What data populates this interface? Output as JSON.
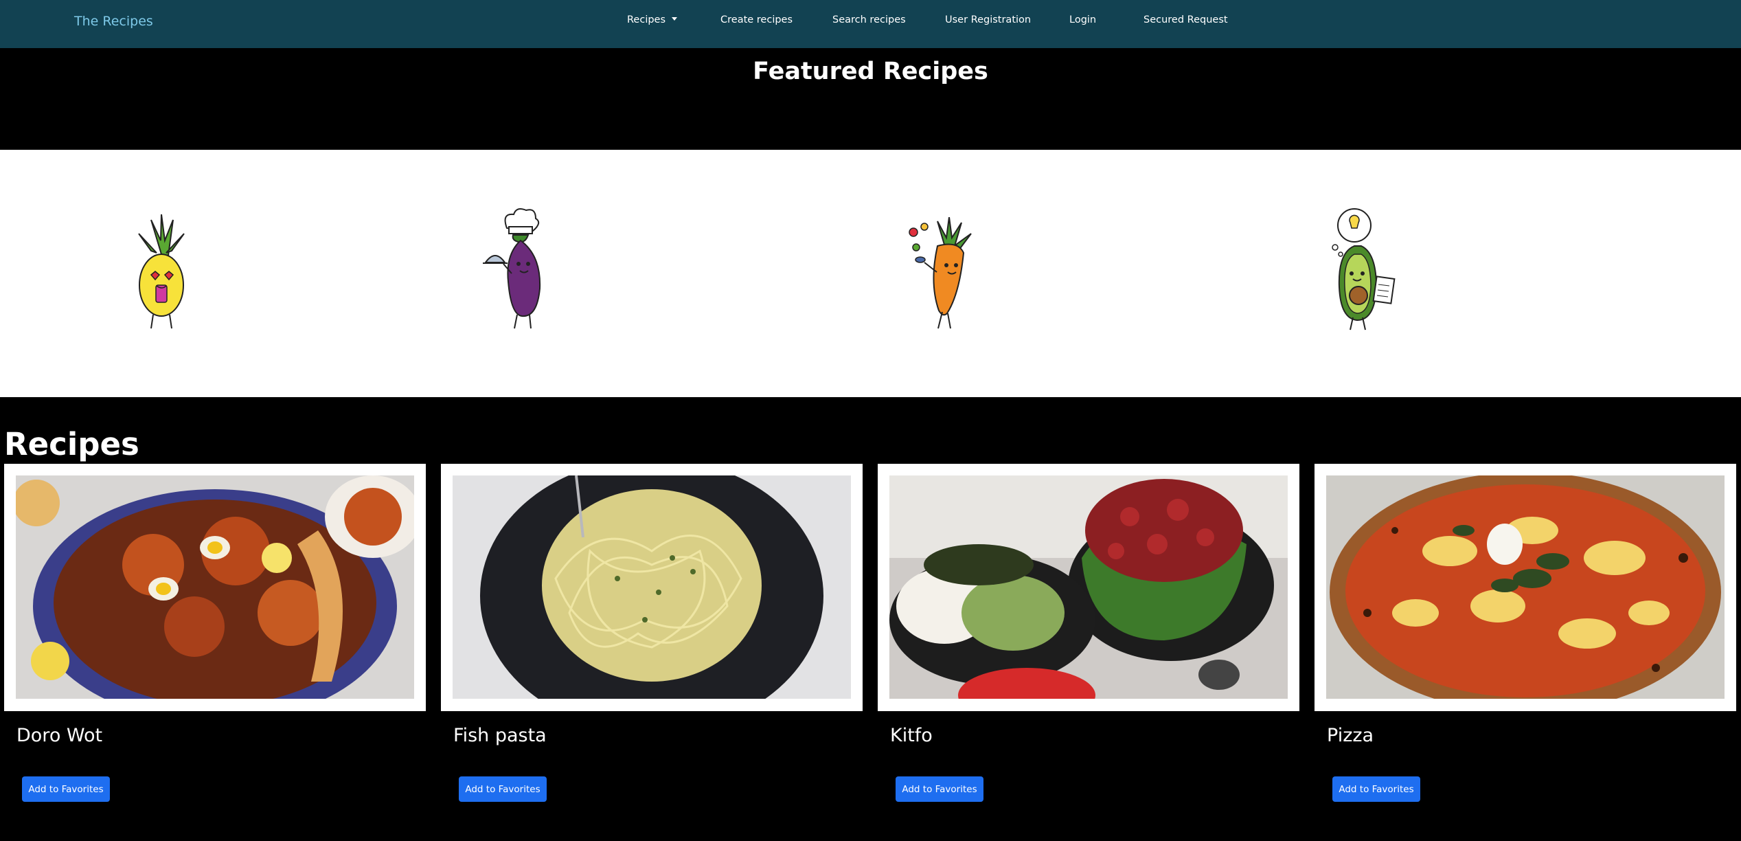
{
  "nav": {
    "brand": "The Recipes",
    "items": [
      {
        "label": "Recipes",
        "has_caret": true
      },
      {
        "label": "Create recipes"
      },
      {
        "label": "Search recipes"
      },
      {
        "label": "User Registration"
      },
      {
        "label": "Login"
      },
      {
        "label": "Secured Request"
      }
    ]
  },
  "featured": {
    "title": "Featured Recipes",
    "mascots": [
      "pineapple-mascot",
      "eggplant-chef-mascot",
      "carrot-mascot",
      "avocado-idea-mascot"
    ]
  },
  "recipes": {
    "heading": "Recipes",
    "cards": [
      {
        "title": "Doro Wot",
        "button": "Add to Favorites",
        "image": "doro-wot-photo"
      },
      {
        "title": "Fish pasta",
        "button": "Add to Favorites",
        "image": "fish-pasta-photo"
      },
      {
        "title": "Kitfo",
        "button": "Add to Favorites",
        "image": "kitfo-photo"
      },
      {
        "title": "Pizza",
        "button": "Add to Favorites",
        "image": "pizza-photo"
      }
    ]
  },
  "colors": {
    "navbar": "#124252",
    "brand": "#7ec9e8",
    "button": "#1e6ef0",
    "page_background": "#000000"
  }
}
